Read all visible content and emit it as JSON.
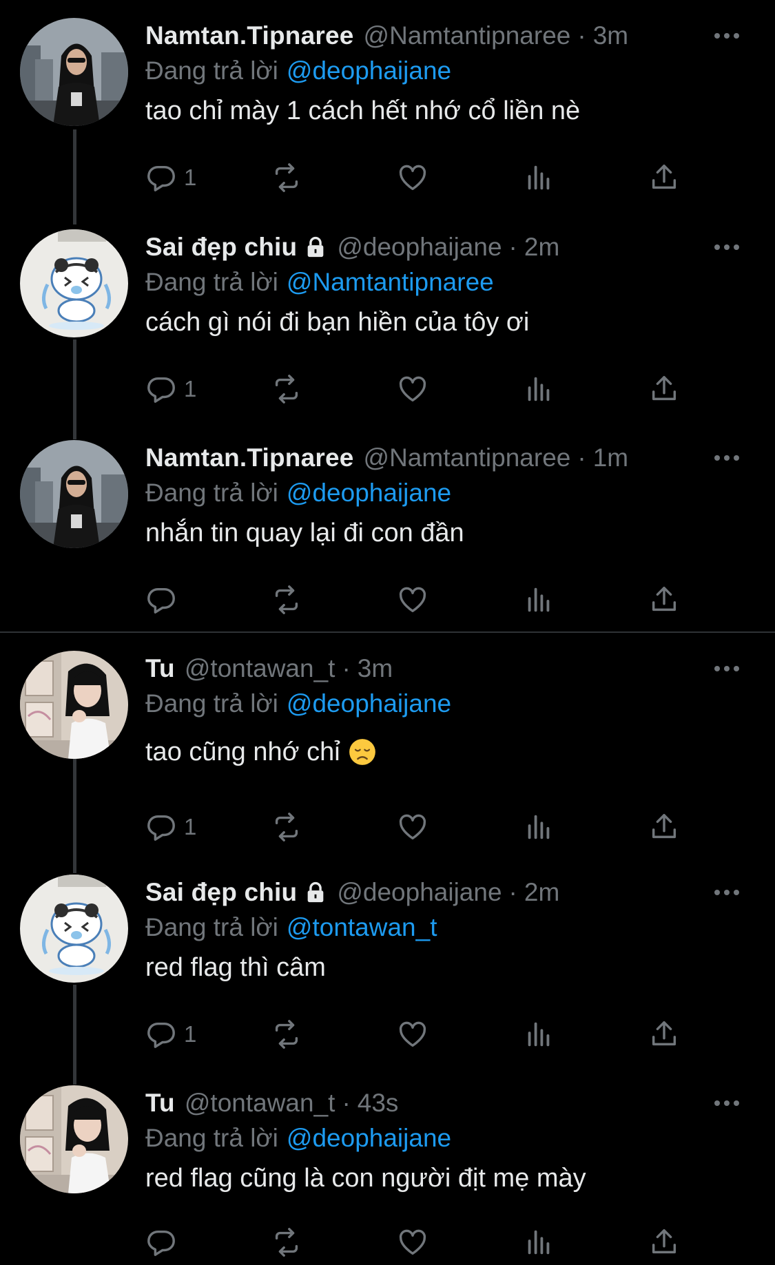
{
  "reply_prefix": "Đang trả lời",
  "tweets": [
    {
      "name": "Namtan.Tipnaree",
      "handle": "@Namtantipnaree",
      "time": "3m",
      "replying_to": "@deophaijane",
      "text": "tao chỉ mày 1 cách hết nhớ cổ liền nè",
      "reply_count": "1",
      "locked": false,
      "avatar": "woman-city-avatar"
    },
    {
      "name": "Sai đẹp chiu",
      "handle": "@deophaijane",
      "time": "2m",
      "replying_to": "@Namtantipnaree",
      "text": "cách gì nói đi bạn hiền của tôy ơi",
      "reply_count": "1",
      "locked": true,
      "avatar": "crying-cartoon-avatar"
    },
    {
      "name": "Namtan.Tipnaree",
      "handle": "@Namtantipnaree",
      "time": "1m",
      "replying_to": "@deophaijane",
      "text": "nhắn tin quay lại đi con đần",
      "reply_count": "",
      "locked": false,
      "avatar": "woman-city-avatar"
    },
    {
      "name": "Tu",
      "handle": "@tontawan_t",
      "time": "3m",
      "replying_to": "@deophaijane",
      "text": "tao cũng nhớ chỉ",
      "reply_count": "1",
      "locked": false,
      "emoji": "disappointed-face",
      "avatar": "girl-portrait-avatar"
    },
    {
      "name": "Sai đẹp chiu",
      "handle": "@deophaijane",
      "time": "2m",
      "replying_to": "@tontawan_t",
      "text": "red flag thì câm",
      "reply_count": "1",
      "locked": true,
      "avatar": "crying-cartoon-avatar"
    },
    {
      "name": "Tu",
      "handle": "@tontawan_t",
      "time": "43s",
      "replying_to": "@deophaijane",
      "text": "red flag cũng là con người địt mẹ mày",
      "reply_count": "",
      "locked": false,
      "avatar": "girl-portrait-avatar"
    }
  ],
  "colors": {
    "background": "#000000",
    "text": "#e7e9ea",
    "muted": "#71767b",
    "link": "#1d9bf0",
    "thread_line": "#333639"
  }
}
